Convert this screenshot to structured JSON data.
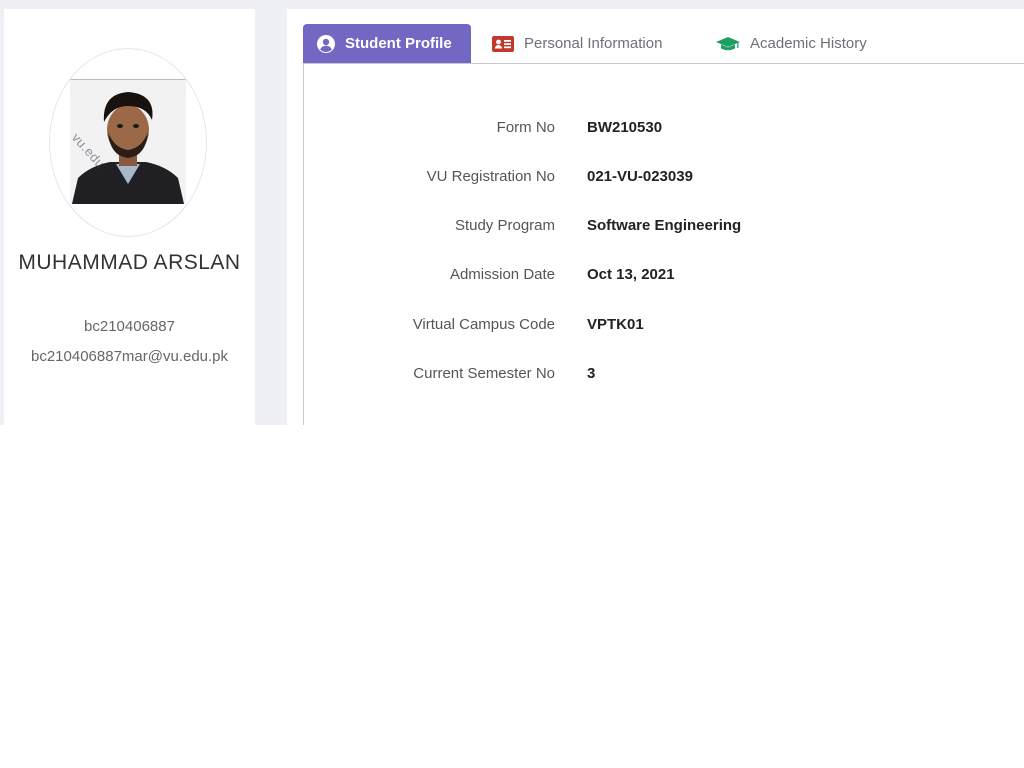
{
  "profile": {
    "name": "MUHAMMAD ARSLAN",
    "student_id": "bc210406887",
    "email": "bc210406887mar@vu.edu.pk",
    "photo_watermark": "vu.edu."
  },
  "tabs": [
    {
      "label": "Student Profile",
      "icon": "user-circle-icon",
      "active": true
    },
    {
      "label": "Personal Information",
      "icon": "id-card-icon",
      "active": false
    },
    {
      "label": "Academic History",
      "icon": "graduation-cap-icon",
      "active": false
    }
  ],
  "details": [
    {
      "label": "Form No",
      "value": "BW210530"
    },
    {
      "label": "VU Registration No",
      "value": "021-VU-023039"
    },
    {
      "label": "Study Program",
      "value": "Software Engineering"
    },
    {
      "label": "Admission Date",
      "value": "Oct 13, 2021"
    },
    {
      "label": "Virtual Campus Code",
      "value": "VPTK01"
    },
    {
      "label": "Current Semester No",
      "value": "3"
    }
  ],
  "colors": {
    "accent": "#7367c4",
    "id_card_icon": "#c0392b",
    "graduation_icon": "#1e9e63",
    "background": "#eef0f5"
  }
}
